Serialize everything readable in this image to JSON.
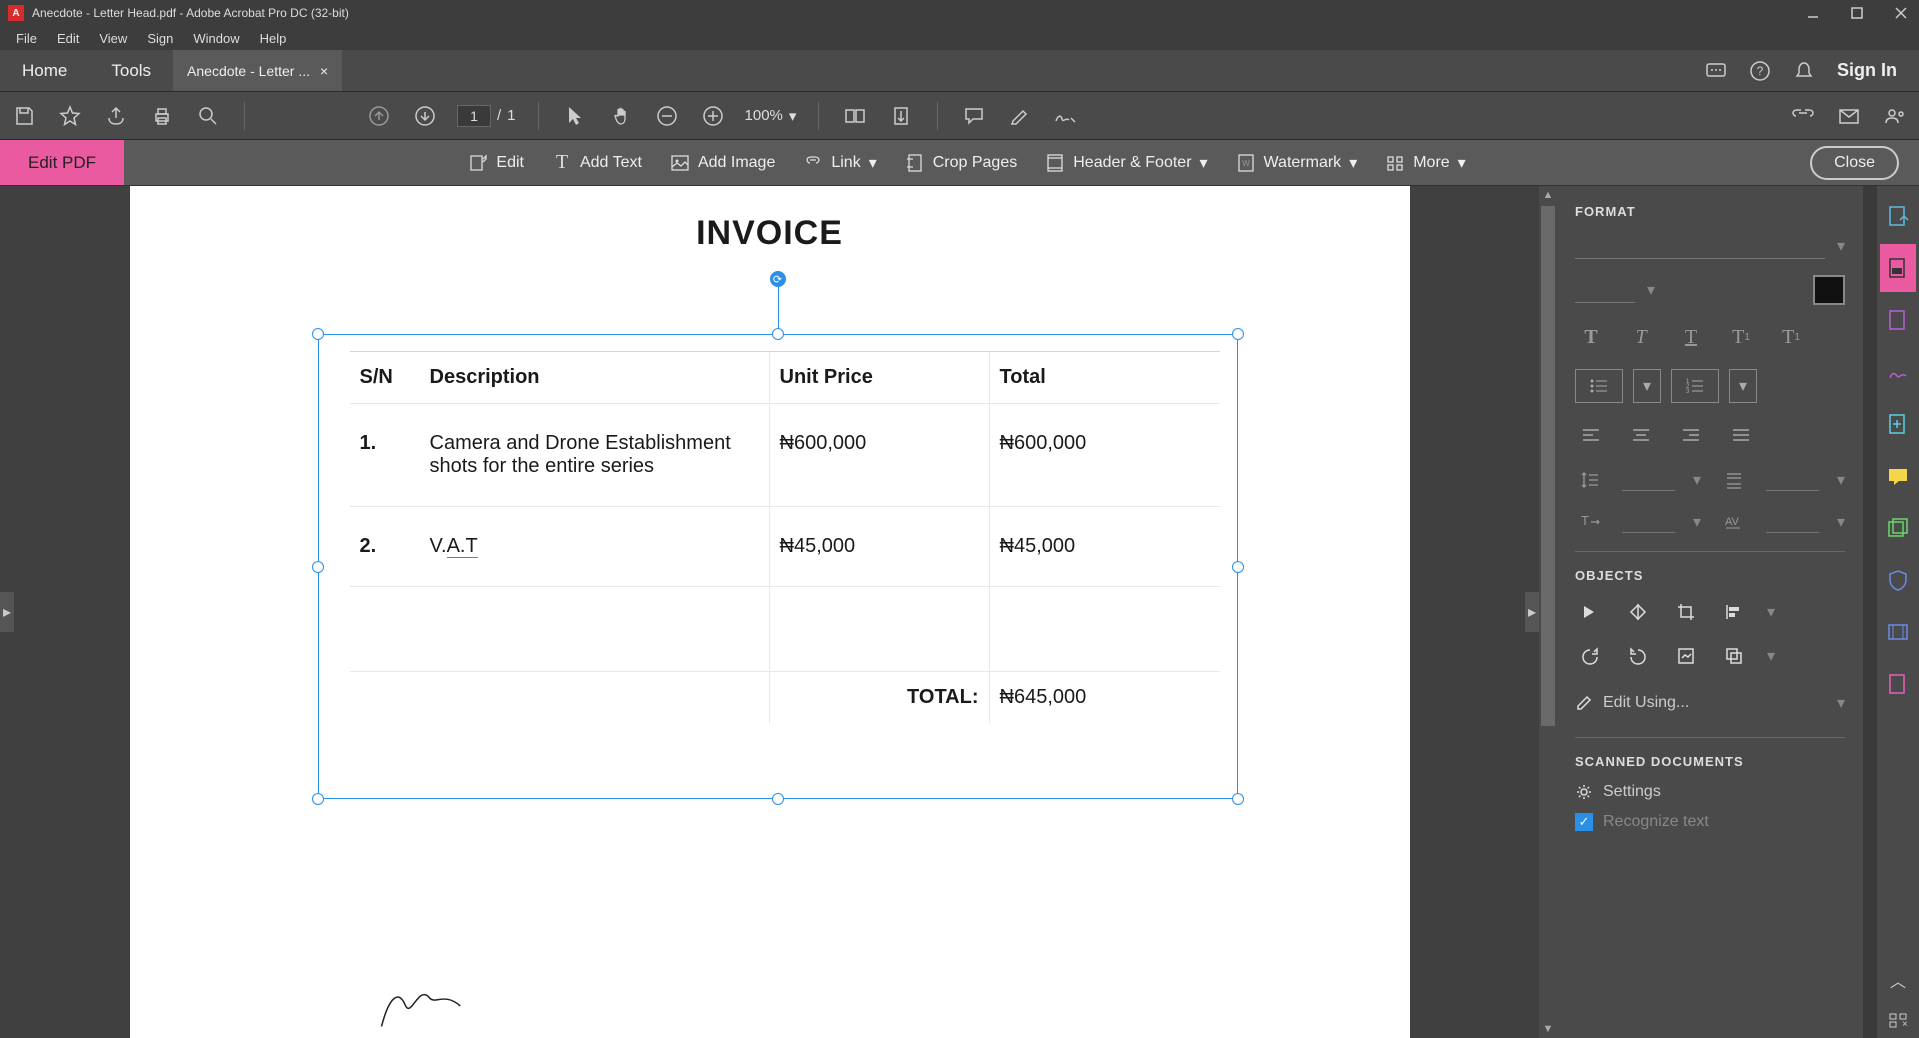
{
  "window": {
    "title": "Anecdote - Letter Head.pdf - Adobe Acrobat Pro DC (32-bit)"
  },
  "menubar": [
    "File",
    "Edit",
    "View",
    "Sign",
    "Window",
    "Help"
  ],
  "tabs": {
    "home": "Home",
    "tools": "Tools",
    "doc": "Anecdote - Letter ...",
    "signin": "Sign In"
  },
  "toolbar": {
    "page_current": "1",
    "page_sep": "/",
    "page_total": "1",
    "zoom": "100%"
  },
  "editpdf": {
    "label": "Edit PDF",
    "edit": "Edit",
    "add_text": "Add Text",
    "add_image": "Add Image",
    "link": "Link",
    "crop": "Crop Pages",
    "header_footer": "Header & Footer",
    "watermark": "Watermark",
    "more": "More",
    "close": "Close"
  },
  "document": {
    "title": "INVOICE",
    "headers": {
      "sn": "S/N",
      "desc": "Description",
      "unit": "Unit Price",
      "total": "Total"
    },
    "rows": [
      {
        "sn": "1.",
        "desc": "Camera and Drone Establishment shots for the entire series",
        "unit": "₦600,000",
        "total": "₦600,000"
      },
      {
        "sn": "2.",
        "desc": "V.A.T",
        "unit": "₦45,000",
        "total": "₦45,000"
      }
    ],
    "total_label": "TOTAL:",
    "total_value": "₦645,000"
  },
  "format_panel": {
    "format_heading": "FORMAT",
    "objects_heading": "OBJECTS",
    "edit_using": "Edit Using...",
    "scanned_heading": "SCANNED DOCUMENTS",
    "settings": "Settings",
    "recognize": "Recognize text"
  }
}
